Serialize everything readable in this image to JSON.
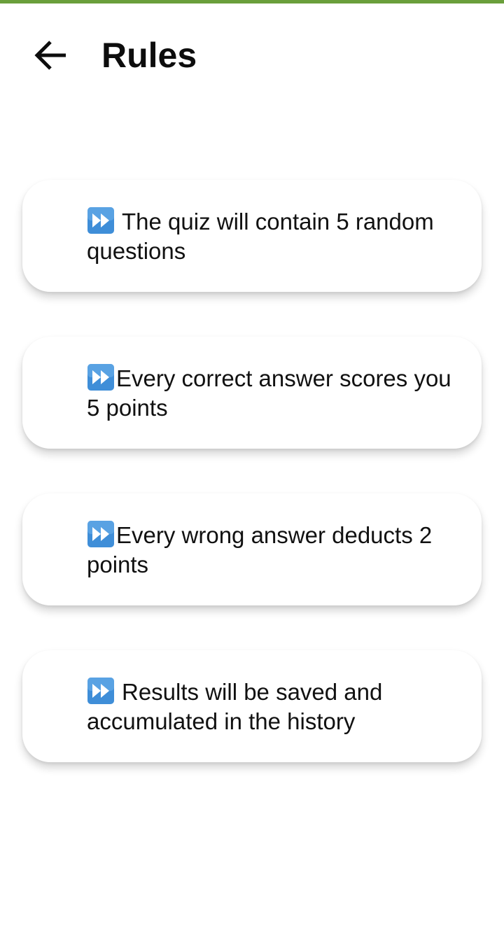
{
  "app": {
    "title": "Rules",
    "accent_color": "#6a9f3b"
  },
  "header": {
    "back_icon": "arrow-left-icon",
    "title": "Rules"
  },
  "rules": [
    {
      "icon": "fast-forward-icon",
      "text": "The quiz will contain 5 random questions"
    },
    {
      "icon": "fast-forward-icon",
      "text": "Every correct answer scores you 5 points"
    },
    {
      "icon": "fast-forward-icon",
      "text": "Every wrong answer deducts 2 points"
    },
    {
      "icon": "fast-forward-icon",
      "text": "Results will be saved and accumulated in the history"
    }
  ],
  "colors": {
    "icon_blue": "#3f8ed8",
    "icon_blue_light": "#6fb3ec"
  }
}
